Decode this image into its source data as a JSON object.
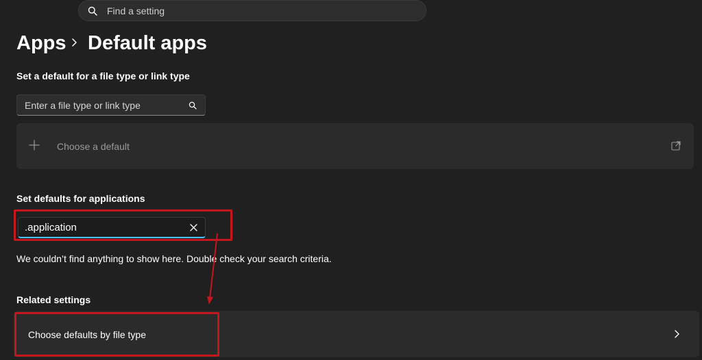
{
  "search": {
    "placeholder": "Find a setting",
    "icon": "search-icon"
  },
  "breadcrumb": {
    "parent": "Apps",
    "current": "Default apps",
    "separator_icon": "chevron-right-icon"
  },
  "file_type_section": {
    "title": "Set a default for a file type or link type",
    "input_placeholder": "Enter a file type or link type",
    "input_icon": "search-icon",
    "choose_card": {
      "label": "Choose a default",
      "leading_icon": "plus-icon",
      "trailing_icon": "open-external-icon"
    }
  },
  "applications_section": {
    "title": "Set defaults for applications",
    "search_value": ".application",
    "clear_icon": "close-icon",
    "empty_message": "We couldn’t find anything to show here. Double check your search criteria."
  },
  "related_settings": {
    "title": "Related settings",
    "items": [
      {
        "label": "Choose defaults by file type",
        "icon": "chevron-right-icon"
      }
    ]
  },
  "colors": {
    "background": "#202020",
    "card": "#2b2b2b",
    "accent": "#4cc2ff",
    "annotation": "#c4161c"
  }
}
